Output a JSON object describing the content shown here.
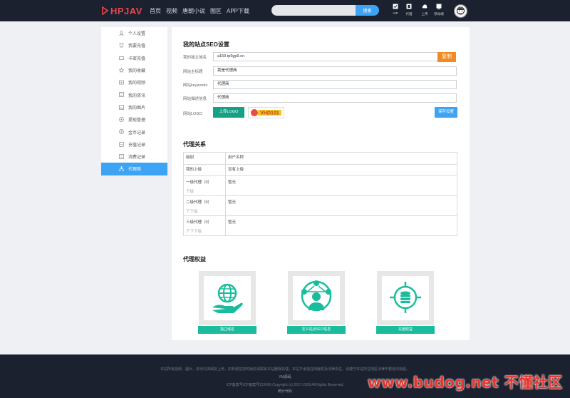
{
  "header": {
    "logo_text": "HPJAV",
    "nav": [
      "首页",
      "视频",
      "唐朝小说",
      "图区",
      "APP下载"
    ],
    "search": {
      "placeholder": "",
      "button": "搜索"
    },
    "icons": [
      {
        "name": "vip-icon",
        "label": "VIP"
      },
      {
        "name": "agent-icon",
        "label": "代理"
      },
      {
        "name": "upload-icon",
        "label": "上传"
      },
      {
        "name": "mobile-icon",
        "label": "移动端"
      }
    ]
  },
  "sidebar": {
    "items": [
      {
        "label": "个人设置",
        "icon": "user-icon"
      },
      {
        "label": "我要充值",
        "icon": "recharge-icon"
      },
      {
        "label": "卡密充值",
        "icon": "card-icon"
      },
      {
        "label": "我的收藏",
        "icon": "star-icon"
      },
      {
        "label": "我的视频",
        "icon": "video-icon"
      },
      {
        "label": "我的资讯",
        "icon": "news-icon"
      },
      {
        "label": "我的图片",
        "icon": "image-icon"
      },
      {
        "label": "提现管理",
        "icon": "withdraw-icon"
      },
      {
        "label": "金币记录",
        "icon": "coin-icon"
      },
      {
        "label": "充值记录",
        "icon": "record-icon"
      },
      {
        "label": "消费记录",
        "icon": "consume-icon"
      },
      {
        "label": "代理商",
        "icon": "agent-tree-icon",
        "active": true
      }
    ]
  },
  "seo": {
    "title": "我的站点SEO设置",
    "fields": [
      {
        "label": "我的独立域名",
        "value": "a159.tp9gp9.cn"
      },
      {
        "label": "网站主标题",
        "value": "我是代理商"
      },
      {
        "label": "网站keywords",
        "value": "代理商"
      },
      {
        "label": "网站描述信息",
        "value": "代理商"
      }
    ],
    "copy_label": "复制",
    "logo_label": "网站LOGO",
    "upload_label": "上传LOGO",
    "logo_preview_text": "VHD101",
    "save_label": "保存设置"
  },
  "relations": {
    "title": "代理关系",
    "headers": [
      "级别",
      "用户名称"
    ],
    "rows": [
      {
        "level": "我的上级",
        "name": "没有上级",
        "sub": ""
      },
      {
        "level": "一级代理（0）",
        "name": "暂无",
        "sub": "下级"
      },
      {
        "level": "二级代理（0）",
        "name": "暂无",
        "sub": "下下级"
      },
      {
        "level": "三级代理（0）",
        "name": "暂无",
        "sub": "下下下级"
      }
    ]
  },
  "benefits": {
    "title": "代理权益",
    "cards": [
      {
        "label": "独立域名",
        "icon": "globe-hand-icon"
      },
      {
        "label": "定义站点SEO信息",
        "icon": "network-user-icon"
      },
      {
        "label": "充值权益",
        "icon": "coin-target-icon"
      }
    ]
  },
  "footer": {
    "line1": "本站所有视频、图片、资讯均由网友上传，如有侵犯您的版权请联系本站删除处理，本站不承担任何版权及法律责任，请遵守本站所在地区法律不要违法观看。",
    "line2": "YM源码",
    "line3": "ICP备案号ICP备案号123456    Copyright (c) 2017-2018 All Rights Reserved.",
    "line4": "统计代码"
  },
  "watermark": "www.budog.net 不懂社区",
  "colors": {
    "accent": "#3ca3f5",
    "teal": "#1abc9c",
    "orange": "#f08a24",
    "dark": "#1c2130",
    "brand_red": "#e5484d"
  }
}
